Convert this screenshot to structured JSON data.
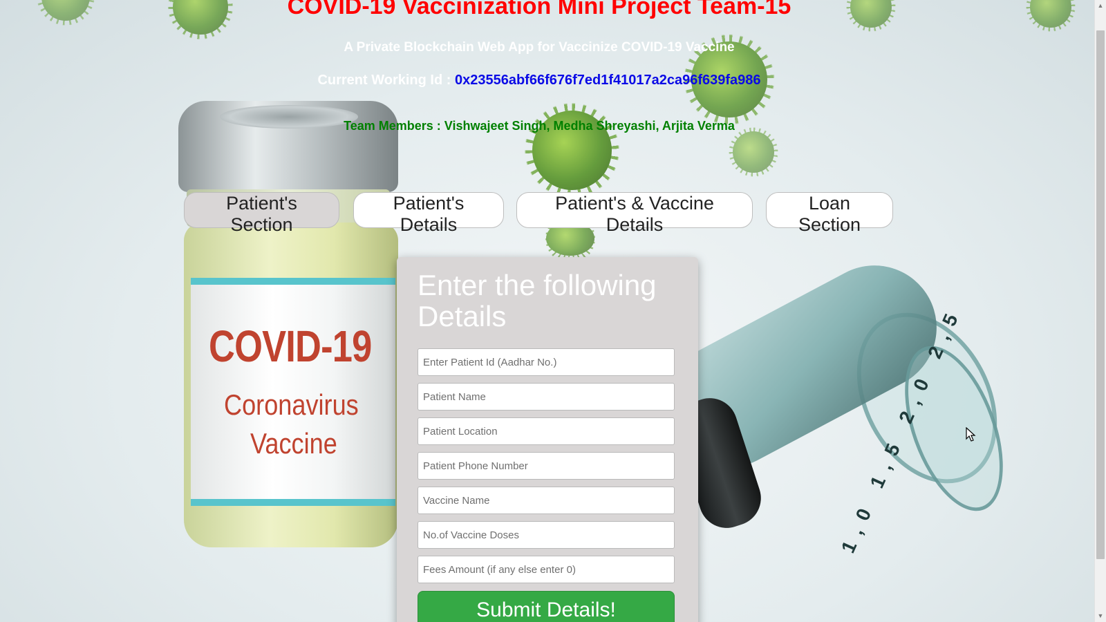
{
  "header": {
    "title": "COVID-19 Vaccinization Mini Project Team-15",
    "subtitle": "A Private Blockchain Web App for Vaccinize COVID-19 Vaccine",
    "working_id_label": "Current Working Id :",
    "working_id_value": "0x23556abf66f676f7ed1f41017a2ca96f639fa986",
    "team": "Team Members : Vishwajeet Singh, Medha Shreyashi, Arjita Verma"
  },
  "nav": {
    "tabs": [
      {
        "label": "Patient's Section",
        "active": true
      },
      {
        "label": "Patient's Details",
        "active": false
      },
      {
        "label": "Patient's & Vaccine Details",
        "active": false
      },
      {
        "label": "Loan Section",
        "active": false
      }
    ]
  },
  "form": {
    "heading": "Enter the following Details",
    "fields": [
      {
        "placeholder": "Enter Patient Id (Aadhar No.)",
        "value": ""
      },
      {
        "placeholder": "Patient Name",
        "value": ""
      },
      {
        "placeholder": "Patient Location",
        "value": ""
      },
      {
        "placeholder": "Patient Phone Number",
        "value": ""
      },
      {
        "placeholder": "Vaccine Name",
        "value": ""
      },
      {
        "placeholder": "No.of Vaccine Doses",
        "value": ""
      },
      {
        "placeholder": "Fees Amount (if any else enter 0)",
        "value": ""
      }
    ],
    "submit_label": "Submit Details!"
  },
  "background": {
    "vial_label_line1": "COVID-19",
    "vial_label_line2": "Coronavirus",
    "vial_label_line3": "Vaccine",
    "syringe_marks": "1,0 1,5 2,0 2,5"
  },
  "colors": {
    "title": "#ff0000",
    "working_id_value": "#0a0ae6",
    "team": "#008000",
    "submit_bg": "#35a945",
    "card_bg": "#d9d6d6",
    "active_tab_bg": "#d9d6d6"
  },
  "icons": {
    "scroll_up": "scroll-up-arrow-icon",
    "scroll_down": "scroll-down-arrow-icon",
    "cursor": "mouse-pointer-icon"
  }
}
